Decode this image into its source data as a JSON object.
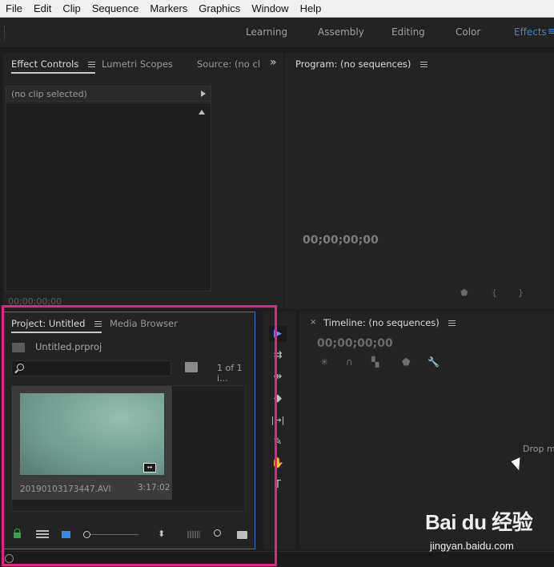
{
  "menu": [
    "File",
    "Edit",
    "Clip",
    "Sequence",
    "Markers",
    "Graphics",
    "Window",
    "Help"
  ],
  "workspaces": {
    "learning": "Learning",
    "assembly": "Assembly",
    "editing": "Editing",
    "color": "Color",
    "effects": "Effects",
    "overflow": "≡"
  },
  "effect_controls": {
    "tab_effect_controls": "Effect Controls",
    "tab_lumetri": "Lumetri Scopes",
    "tab_source": "Source: (no cl",
    "overflow": "»",
    "clip_label": "(no clip selected)",
    "timecode": "00;00;00;00"
  },
  "program": {
    "title": "Program: (no sequences)",
    "timecode": "00;00;00;00",
    "ctrl_marker": "⬟",
    "ctrl_in": "{",
    "ctrl_out": "}"
  },
  "project": {
    "tab_project": "Project: Untitled",
    "tab_media": "Media Browser",
    "project_file": "Untitled.prproj",
    "search_placeholder": "",
    "item_count": "1 of 1 i...",
    "clip": {
      "name": "20190103173447.AVI",
      "duration": "3:17:02"
    },
    "sort_icon": "⬍"
  },
  "tools": {
    "selection": "▶",
    "track_select": "⇉",
    "ripple": "⇹",
    "razor": "◆",
    "slip": "|↔|",
    "pen": "✎",
    "hand": "✋",
    "type": "T"
  },
  "timeline": {
    "close": "×",
    "title": "Timeline: (no sequences)",
    "timecode": "00;00;00;00",
    "drop_text": "Drop m"
  },
  "icons": {
    "lock": "lock-icon",
    "list_view": "list-view-icon",
    "icon_view": "icon-view-icon",
    "sort": "sort-icon",
    "automate": "automate-icon",
    "find": "find-icon",
    "new_bin": "new-bin-icon"
  },
  "watermark": {
    "logo": "Bai du 经验",
    "url": "jingyan.baidu.com"
  },
  "colors": {
    "accent": "#2d8ceb",
    "highlight": "#e5218c",
    "lock": "#2fa84a"
  }
}
